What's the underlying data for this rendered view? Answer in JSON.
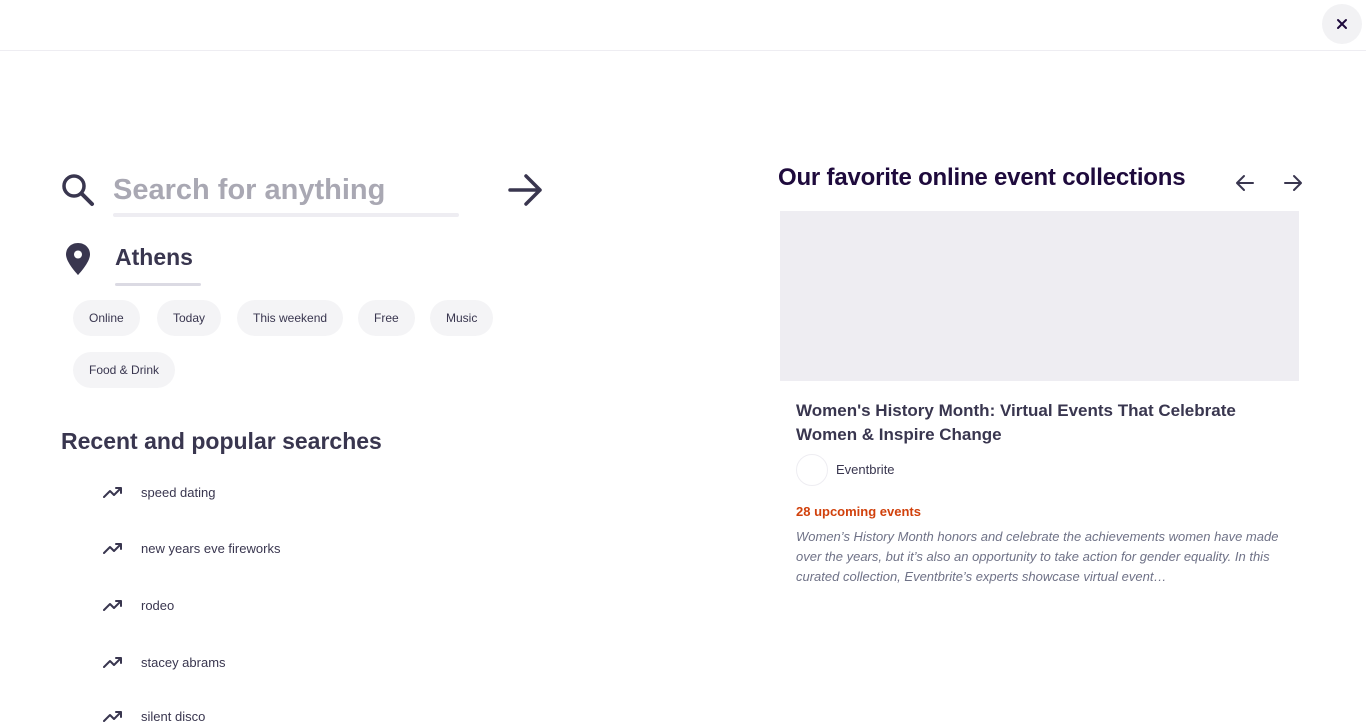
{
  "search": {
    "placeholder": "Search for anything",
    "value": ""
  },
  "location": {
    "value": "Athens"
  },
  "chips": [
    {
      "label": "Online"
    },
    {
      "label": "Today"
    },
    {
      "label": "This weekend"
    },
    {
      "label": "Free"
    },
    {
      "label": "Music"
    },
    {
      "label": "Food & Drink"
    }
  ],
  "recent": {
    "title": "Recent and popular searches",
    "items": [
      {
        "label": "speed dating"
      },
      {
        "label": "new years eve fireworks"
      },
      {
        "label": "rodeo"
      },
      {
        "label": "stacey abrams"
      },
      {
        "label": "silent disco"
      }
    ]
  },
  "collections": {
    "title": "Our favorite online event collections",
    "card": {
      "title": "Women's History Month: Virtual Events That Celebrate Women & Inspire Change",
      "organizer": "Eventbrite",
      "upcoming": "28 upcoming events",
      "description": "Women’s History Month honors and celebrate the achievements women have made over the years, but it’s also an opportunity to take action for gender equality. In this curated collection, Eventbrite’s experts showcase virtual event…"
    }
  },
  "icons": {
    "close": "close-icon",
    "search": "search-icon",
    "submit": "arrow-right-icon",
    "location": "map-pin-icon",
    "trending": "trending-up-icon",
    "prev": "arrow-left-icon",
    "next": "arrow-right-icon"
  },
  "colors": {
    "text": "#39364f",
    "heading": "#1e0a3c",
    "accent_orange": "#d1410c",
    "chip_bg": "#f4f4f6",
    "placeholder": "#a9a8b3"
  }
}
